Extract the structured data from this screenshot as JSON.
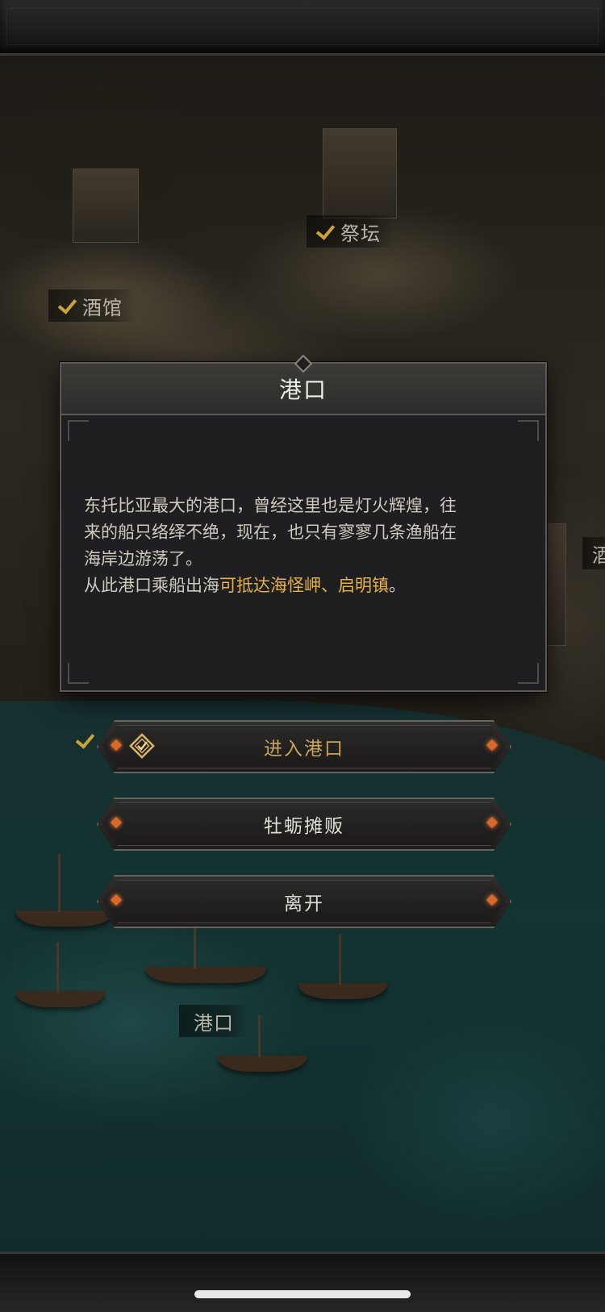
{
  "map": {
    "labels": {
      "altar": "祭坛",
      "tavern": "酒馆",
      "port": "港口",
      "partial_right": "酒"
    }
  },
  "dialog": {
    "title": "港口",
    "description_line1": "东托比亚最大的港口，曾经这里也是灯火辉煌，往",
    "description_line2": "来的船只络绎不绝，现在，也只有寥寥几条渔船在",
    "description_line3": "海岸边游荡了。",
    "description_prefix": "从此港口乘船出海",
    "description_highlight": "可抵达海怪岬、启明镇",
    "description_suffix": "。"
  },
  "options": [
    {
      "label": "进入港口",
      "color": "#c9a560"
    },
    {
      "label": "牡蛎摊贩",
      "color": "#e0ddd5"
    },
    {
      "label": "离开",
      "color": "#e0ddd5"
    }
  ],
  "colors": {
    "accent_gold": "#e6b24a",
    "gem_orange": "#d76a2b"
  }
}
